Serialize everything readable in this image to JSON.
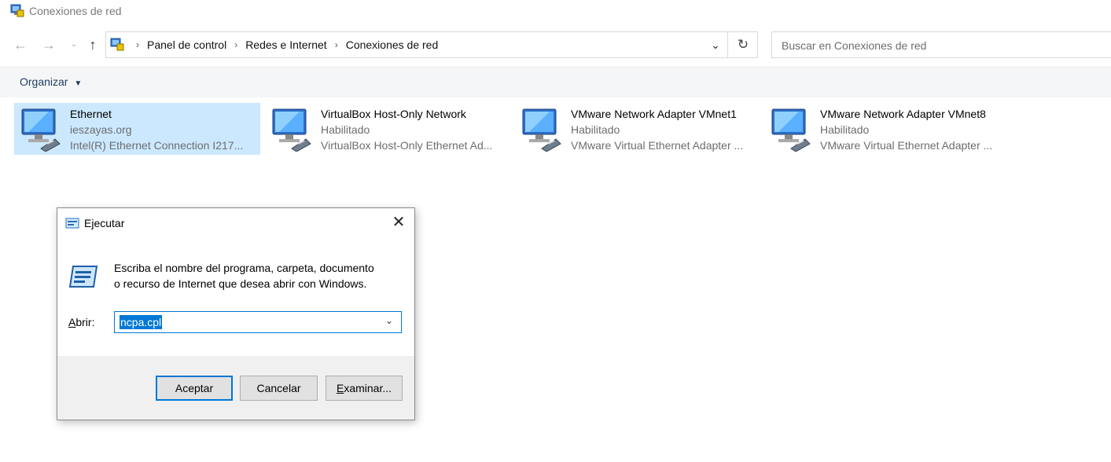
{
  "window": {
    "title": "Conexiones de red"
  },
  "navigation": {
    "breadcrumbs": [
      "Panel de control",
      "Redes e Internet",
      "Conexiones de red"
    ],
    "search_placeholder": "Buscar en Conexiones de red"
  },
  "toolbar": {
    "organize_label": "Organizar"
  },
  "connections": [
    {
      "name": "Ethernet",
      "status": "ieszayas.org",
      "device": "Intel(R) Ethernet Connection I217...",
      "selected": true
    },
    {
      "name": "VirtualBox Host-Only Network",
      "status": "Habilitado",
      "device": "VirtualBox Host-Only Ethernet Ad..."
    },
    {
      "name": "VMware Network Adapter VMnet1",
      "status": "Habilitado",
      "device": "VMware Virtual Ethernet Adapter ..."
    },
    {
      "name": "VMware Network Adapter VMnet8",
      "status": "Habilitado",
      "device": "VMware Virtual Ethernet Adapter ..."
    }
  ],
  "run_dialog": {
    "title": "Ejecutar",
    "description_line1": "Escriba el nombre del programa, carpeta, documento",
    "description_line2": "o recurso de Internet que desea abrir con Windows.",
    "open_label_accel": "A",
    "open_label_rest": "brir:",
    "input_value": "ncpa.cpl",
    "ok_label": "Aceptar",
    "cancel_label": "Cancelar",
    "browse_label_accel": "E",
    "browse_label_rest": "xaminar..."
  }
}
